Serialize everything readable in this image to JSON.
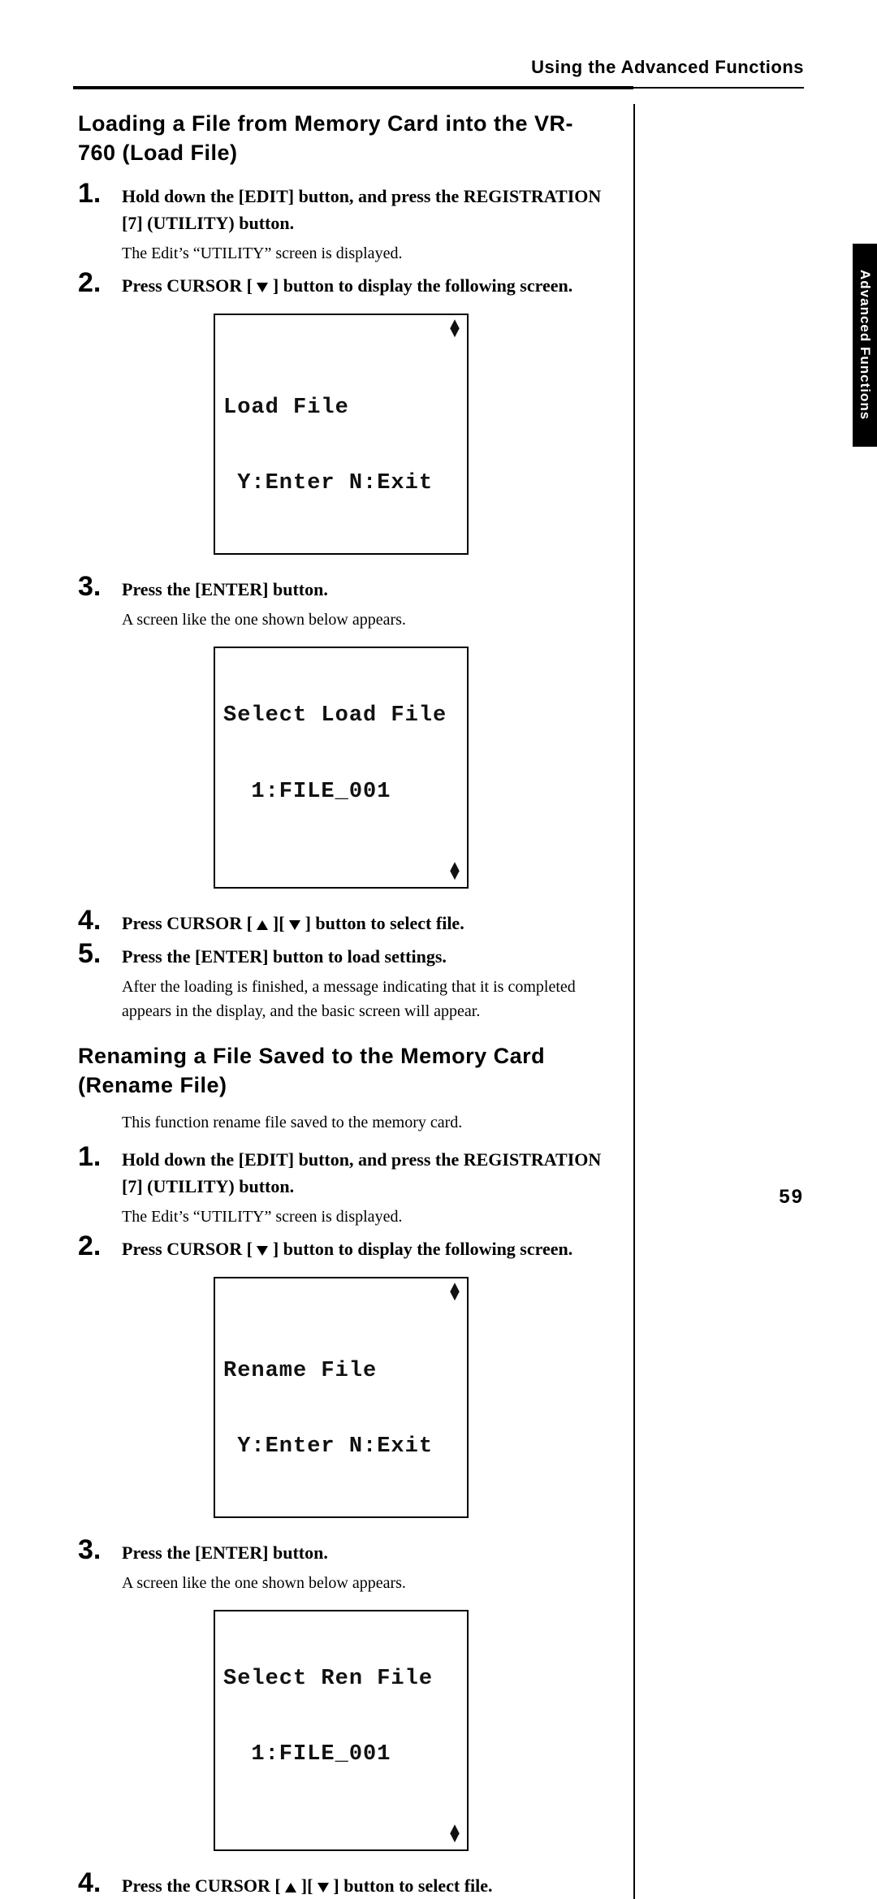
{
  "runningHead": "Using the Advanced Functions",
  "sideTab": "Advanced Functions",
  "pageNumber": "59",
  "sectionA": {
    "title": "Loading a File from Memory Card into the VR-760 (Load File)",
    "steps": [
      {
        "n": "1",
        "bold": "Hold down the [EDIT] button, and press the REGISTRATION [7] (UTILITY) button.",
        "plain": "The Edit’s “UTILITY” screen is displayed."
      },
      {
        "n": "2",
        "bold_pre": "Press CURSOR [ ",
        "bold_post": " ] button to display the following screen.",
        "lcd": {
          "line1": "Load File",
          "line2": " Y:Enter N:Exit",
          "arrows": "top"
        }
      },
      {
        "n": "3",
        "bold": "Press the [ENTER] button.",
        "plain": "A screen like the one shown below appears.",
        "lcd": {
          "line1": "Select Load File",
          "line2": "  1:FILE_001",
          "arrows": "bottom"
        }
      },
      {
        "n": "4",
        "bold_pre": "Press CURSOR [ ",
        "bold_mid": " ][ ",
        "bold_post": " ] button to select file."
      },
      {
        "n": "5",
        "bold": "Press the [ENTER] button to load settings.",
        "plain": "After the loading is finished, a message indicating that it is completed appears in the display, and the basic screen will appear."
      }
    ]
  },
  "sectionB": {
    "title": "Renaming a File Saved to the Memory Card (Rename File)",
    "intro": "This function rename file saved to the memory card.",
    "steps": [
      {
        "n": "1",
        "bold": "Hold down the [EDIT] button, and press the REGISTRATION [7] (UTILITY) button.",
        "plain": "The Edit’s “UTILITY” screen is displayed."
      },
      {
        "n": "2",
        "bold_pre": "Press CURSOR [ ",
        "bold_post": " ] button to display the following screen.",
        "lcd": {
          "line1": "Rename File",
          "line2": " Y:Enter N:Exit",
          "arrows": "top"
        }
      },
      {
        "n": "3",
        "bold": "Press the [ENTER] button.",
        "plain": "A screen like the one shown below appears.",
        "lcd": {
          "line1": "Select Ren File",
          "line2": "  1:FILE_001",
          "arrows": "bottom"
        }
      },
      {
        "n": "4",
        "bold_pre": "Press the CURSOR [ ",
        "bold_mid": " ][ ",
        "bold_post": " ] button to select file."
      }
    ]
  }
}
